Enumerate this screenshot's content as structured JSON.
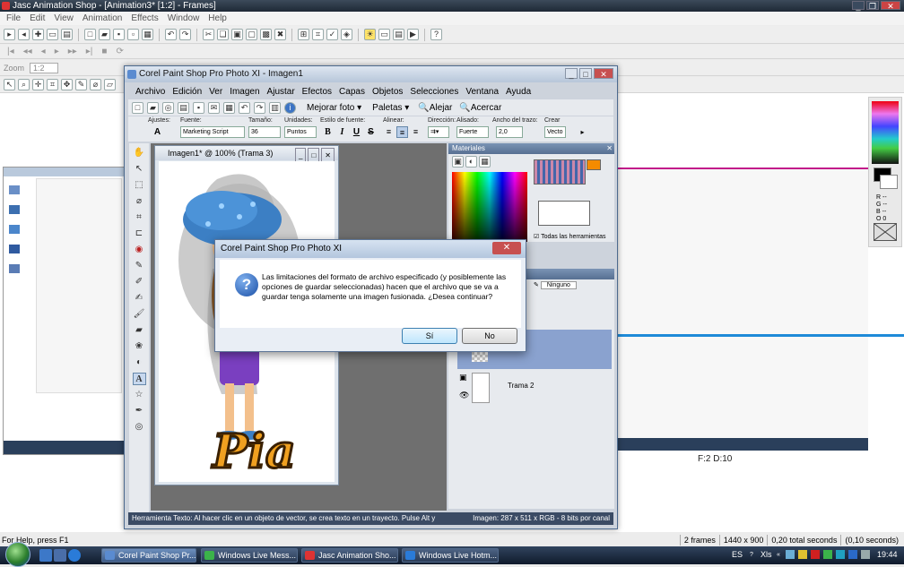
{
  "jasc": {
    "title": "Jasc Animation Shop - [Animation3* [1:2] - Frames]",
    "menu": [
      "File",
      "Edit",
      "View",
      "Animation",
      "Effects",
      "Window",
      "Help"
    ],
    "zoom_label": "Zoom",
    "zoom_value": "1:2",
    "frame_info": "F:2   D:10",
    "status_left": "For Help, press F1",
    "status_right": [
      "2 frames",
      "1440 x 900",
      "0,20 total seconds",
      "(0,10 seconds)"
    ],
    "palette_rgb": [
      "R --",
      "G --",
      "B --",
      "O 0"
    ]
  },
  "psp": {
    "title": "Corel Paint Shop Pro Photo XI - Imagen1",
    "menu": [
      "Archivo",
      "Edición",
      "Ver",
      "Imagen",
      "Ajustar",
      "Efectos",
      "Capas",
      "Objetos",
      "Selecciones",
      "Ventana",
      "Ayuda"
    ],
    "toolbar1": {
      "mejorar": "Mejorar foto",
      "paletas": "Paletas",
      "alejar": "Alejar",
      "acercar": "Acercar"
    },
    "options": {
      "ajustes_label": "Ajustes:",
      "fuente_label": "Fuente:",
      "fuente_value": "Marketing Script",
      "tamano_label": "Tamaño:",
      "tamano_value": "36",
      "unidades_label": "Unidades:",
      "unidades_value": "Puntos",
      "estilo_label": "Estilo de fuente:",
      "alinear_label": "Alinear:",
      "direccion_label": "Dirección:",
      "alisado_label": "Alisado:",
      "alisado_value": "Fuerte",
      "ancho_label": "Ancho del trazo:",
      "ancho_value": "2,0",
      "crear_label": "Crear",
      "crear_value": "Vecto"
    },
    "image_window_title": "Imagen1* @ 100% (Trama 3)",
    "image_text": "Pia",
    "materials_title": "Materiales",
    "materials_all_tools": "Todas las herramientas",
    "layers_none": "Ninguno",
    "layer_name": "Trama 2",
    "status_left": "Herramienta Texto: Al hacer clic en un objeto de vector, se crea texto en un trayecto. Pulse Alt y",
    "status_right": "Imagen:  287 x 511 x RGB  -  8 bits por canal"
  },
  "dialog": {
    "title": "Corel Paint Shop Pro Photo XI",
    "message": "Las limitaciones del formato de archivo especificado (y posiblemente las opciones de guardar seleccionadas) hacen que el archivo que se va a guardar tenga solamente una imagen fusionada. ¿Desea continuar?",
    "yes": "Sí",
    "no": "No"
  },
  "taskbar": {
    "buttons": [
      "Corel Paint Shop Pr...",
      "Windows Live Mess...",
      "Jasc Animation Sho...",
      "Windows Live Hotm..."
    ],
    "lang": "ES",
    "xls": "Xls",
    "clock": "19:44"
  },
  "colors": {
    "taskbar": "#1a2a42",
    "accent_magenta": "#c21a8a",
    "accent_blue": "#1e8ad8",
    "dialog_close": "#c75050"
  }
}
